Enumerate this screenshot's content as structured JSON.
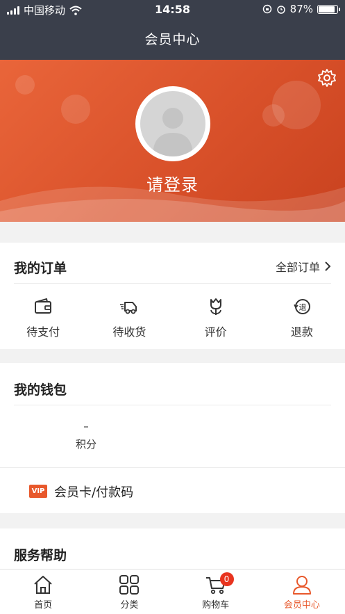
{
  "status_bar": {
    "carrier": "中国移动",
    "time": "14:58",
    "battery": "87%",
    "battery_level": 0.87
  },
  "header": {
    "title": "会员中心"
  },
  "profile": {
    "login_text": "请登录",
    "settings_icon": "gear-icon",
    "avatar_icon": "default-avatar"
  },
  "orders": {
    "title": "我的订单",
    "all_label": "全部订单",
    "items": [
      {
        "label": "待支付",
        "icon": "wallet-icon"
      },
      {
        "label": "待收货",
        "icon": "delivery-truck-icon"
      },
      {
        "label": "评价",
        "icon": "tulip-icon"
      },
      {
        "label": "退款",
        "icon": "refund-icon"
      }
    ]
  },
  "wallet": {
    "title": "我的钱包",
    "points_value": "–",
    "points_label": "积分",
    "vip_badge": "VIP",
    "vip_label": "会员卡/付款码"
  },
  "service": {
    "title": "服务帮助"
  },
  "tabbar": {
    "items": [
      {
        "label": "首页",
        "icon": "home-icon"
      },
      {
        "label": "分类",
        "icon": "category-grid-icon"
      },
      {
        "label": "购物车",
        "icon": "cart-icon",
        "badge": "0"
      },
      {
        "label": "会员中心",
        "icon": "user-icon",
        "active": true
      }
    ]
  },
  "colors": {
    "accent": "#e8582b",
    "topbar": "#3a3f4b",
    "badge": "#e8341f"
  }
}
